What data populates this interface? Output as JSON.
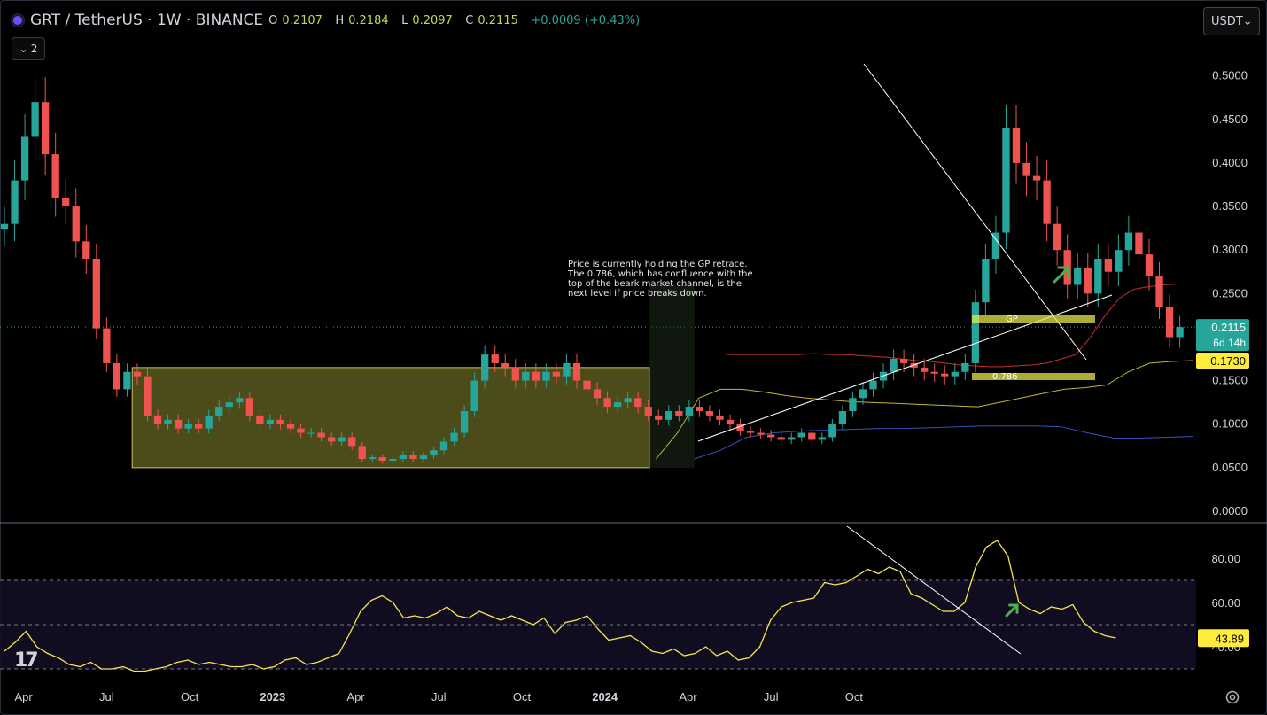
{
  "header": {
    "symbol": "GRT / TetherUS · 1W · BINANCE",
    "o_label": "O",
    "o_value": "0.2107",
    "h_label": "H",
    "h_value": "0.2184",
    "l_label": "L",
    "l_value": "0.2097",
    "c_label": "C",
    "c_value": "0.2115",
    "change": "+0.0009 (+0.43%)",
    "collapse_count": "2"
  },
  "currency_selector": {
    "label": "USDT"
  },
  "colors": {
    "up": "#26a69a",
    "down": "#ef5350",
    "background": "#000000",
    "box": "#7b7a2b",
    "yellow": "#e9e24a",
    "rsi": "#f7e654",
    "grid": "#2a2e39"
  },
  "icons": [
    "grt-coin-icon",
    "chevron-down-icon",
    "tradingview-logo-icon",
    "settings-gear-icon",
    "green-arrow-icon"
  ],
  "chart_data": {
    "type": "candlestick",
    "timeframe": "1W",
    "ylim": [
      0.0,
      0.52
    ],
    "y_ticks": [
      "0.5000",
      "0.4500",
      "0.4000",
      "0.3500",
      "0.3000",
      "0.2500",
      "0.2000",
      "0.1500",
      "0.1000",
      "0.0500",
      "0.0000"
    ],
    "x_ticks": [
      "Apr",
      "Jul",
      "Oct",
      "2023",
      "Apr",
      "Jul",
      "Oct",
      "2024",
      "Apr",
      "Jul",
      "Oct"
    ],
    "x_ticks_bold": [
      "2023",
      "2024"
    ],
    "x_range_weeks": [
      0,
      186
    ],
    "x_tick_weeks": [
      3,
      16,
      29,
      42,
      55,
      68,
      81,
      94,
      107,
      120,
      133
    ],
    "price_labels": [
      {
        "text": "0.2115",
        "sub": "6d 14h",
        "value": 0.2115,
        "color": "#26a69a"
      },
      {
        "text": "0.1730",
        "value": 0.173,
        "color": "#ffeb3b"
      }
    ],
    "last_price": 0.2115,
    "closes": [
      0.33,
      0.38,
      0.43,
      0.47,
      0.41,
      0.36,
      0.35,
      0.31,
      0.29,
      0.21,
      0.17,
      0.14,
      0.16,
      0.155,
      0.11,
      0.1,
      0.105,
      0.095,
      0.1,
      0.095,
      0.11,
      0.12,
      0.125,
      0.13,
      0.11,
      0.1,
      0.105,
      0.1,
      0.095,
      0.09,
      0.09,
      0.085,
      0.08,
      0.085,
      0.075,
      0.06,
      0.062,
      0.058,
      0.06,
      0.065,
      0.06,
      0.064,
      0.07,
      0.08,
      0.09,
      0.115,
      0.15,
      0.18,
      0.17,
      0.165,
      0.15,
      0.16,
      0.15,
      0.16,
      0.155,
      0.17,
      0.15,
      0.14,
      0.13,
      0.12,
      0.125,
      0.13,
      0.12,
      0.11,
      0.105,
      0.115,
      0.11,
      0.12,
      0.115,
      0.11,
      0.105,
      0.1,
      0.092,
      0.09,
      0.088,
      0.085,
      0.082,
      0.085,
      0.09,
      0.082,
      0.085,
      0.1,
      0.115,
      0.13,
      0.14,
      0.15,
      0.16,
      0.175,
      0.17,
      0.165,
      0.16,
      0.158,
      0.155,
      0.16,
      0.17,
      0.24,
      0.29,
      0.32,
      0.44,
      0.4,
      0.385,
      0.38,
      0.33,
      0.3,
      0.26,
      0.28,
      0.25,
      0.29,
      0.275,
      0.3,
      0.32,
      0.295,
      0.27,
      0.235,
      0.2,
      0.2115
    ],
    "ma_red": [
      0.18,
      0.18,
      0.18,
      0.18,
      0.18,
      0.18,
      0.181,
      0.18,
      0.18,
      0.179,
      0.178,
      0.177,
      0.175,
      0.173,
      0.172,
      0.17,
      0.168,
      0.167,
      0.166,
      0.166,
      0.167,
      0.168,
      0.17,
      0.175,
      0.18,
      0.2,
      0.225,
      0.245,
      0.255,
      0.258,
      0.26,
      0.261,
      0.261
    ],
    "ma_yellow": [
      0.06,
      0.09,
      0.13,
      0.14,
      0.14,
      0.137,
      0.133,
      0.13,
      0.128,
      0.126,
      0.125,
      0.124,
      0.123,
      0.122,
      0.121,
      0.12,
      0.125,
      0.13,
      0.135,
      0.14,
      0.142,
      0.145,
      0.16,
      0.17,
      0.172,
      0.173
    ],
    "ma_blue": [
      0.06,
      0.07,
      0.085,
      0.09,
      0.092,
      0.093,
      0.094,
      0.095,
      0.095,
      0.096,
      0.097,
      0.098,
      0.098,
      0.098,
      0.097,
      0.09,
      0.084,
      0.084,
      0.085,
      0.086
    ],
    "annotations": {
      "note": "Price is currently holding the GP retrace.\nThe 0.786, which has confluence with the\ntop of the beark market channel, is the\nnext level if price breaks down.",
      "gp_label": "GP",
      "fib_label": "0.786"
    },
    "rsi": {
      "y_ticks": [
        "80.00",
        "60.00",
        "40.00"
      ],
      "current": "43.89",
      "values": [
        38,
        42,
        47,
        40,
        37,
        35,
        32,
        31,
        33,
        30,
        30,
        31,
        29,
        29,
        30,
        31,
        33,
        34,
        32,
        33,
        32,
        31,
        31,
        32,
        30,
        31,
        34,
        35,
        32,
        33,
        35,
        37,
        46,
        56,
        61,
        63,
        60,
        53,
        54,
        53,
        55,
        58,
        54,
        53,
        56,
        54,
        52,
        54,
        52,
        50,
        53,
        46,
        51,
        52,
        54,
        48,
        43,
        44,
        45,
        42,
        38,
        37,
        39,
        36,
        37,
        40,
        36,
        38,
        34,
        35,
        40,
        52,
        58,
        60,
        61,
        62,
        69,
        68,
        69,
        72,
        75,
        73,
        76,
        74,
        64,
        62,
        59,
        56,
        56,
        60,
        76,
        85,
        88,
        81,
        60,
        57,
        55,
        58,
        57,
        59,
        51,
        47,
        45,
        44
      ]
    }
  }
}
